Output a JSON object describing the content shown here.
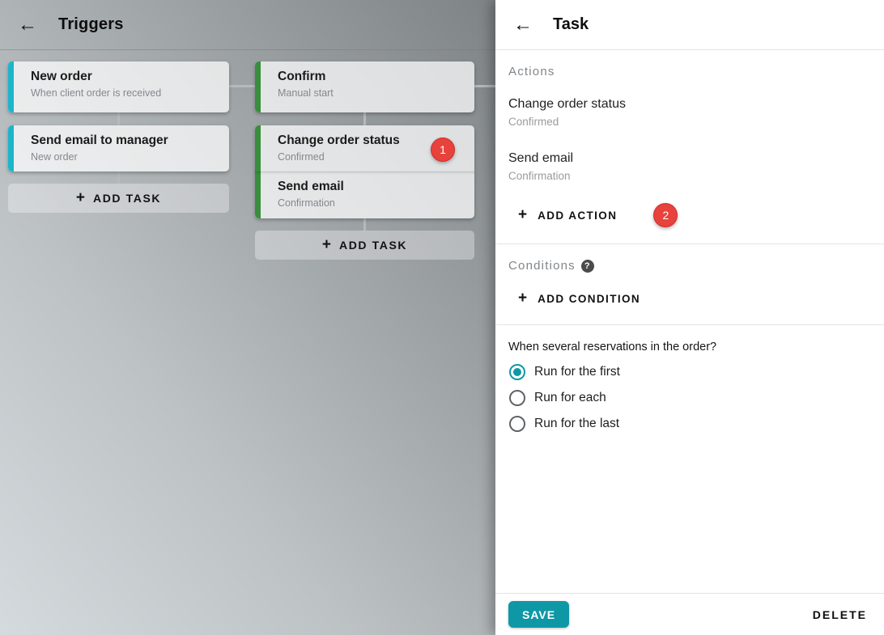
{
  "icons": {
    "back": "←",
    "plus": "+",
    "help": "?"
  },
  "colors": {
    "trigger_accent": "#1cb5cc",
    "task_accent": "#388e3c",
    "badge_red": "#e8423c",
    "primary_teal": "#0e98a6"
  },
  "workspace": {
    "header": {
      "title": "Triggers"
    },
    "columns": [
      {
        "cards": [
          {
            "title": "New order",
            "subtitle": "When client order is received"
          },
          {
            "title": "Send email to manager",
            "subtitle": "New order"
          }
        ],
        "add_task_label": "ADD TASK"
      },
      {
        "cards": [
          {
            "title": "Confirm",
            "subtitle": "Manual start"
          }
        ],
        "stack": {
          "rows": [
            {
              "title": "Change order status",
              "subtitle": "Confirmed",
              "badge": "1"
            },
            {
              "title": "Send email",
              "subtitle": "Confirmation"
            }
          ]
        },
        "add_task_label": "ADD TASK"
      }
    ]
  },
  "panel": {
    "header": {
      "title": "Task"
    },
    "actions": {
      "label": "Actions",
      "items": [
        {
          "title": "Change order status",
          "subtitle": "Confirmed"
        },
        {
          "title": "Send email",
          "subtitle": "Confirmation"
        }
      ],
      "add_label": "ADD ACTION",
      "badge": "2"
    },
    "conditions": {
      "label": "Conditions",
      "add_label": "ADD CONDITION"
    },
    "run_mode": {
      "question": "When several reservations in the order?",
      "options": [
        {
          "label": "Run for the first",
          "selected": true
        },
        {
          "label": "Run for each",
          "selected": false
        },
        {
          "label": "Run for the last",
          "selected": false
        }
      ]
    },
    "footer": {
      "save_label": "SAVE",
      "delete_label": "DELETE"
    }
  }
}
